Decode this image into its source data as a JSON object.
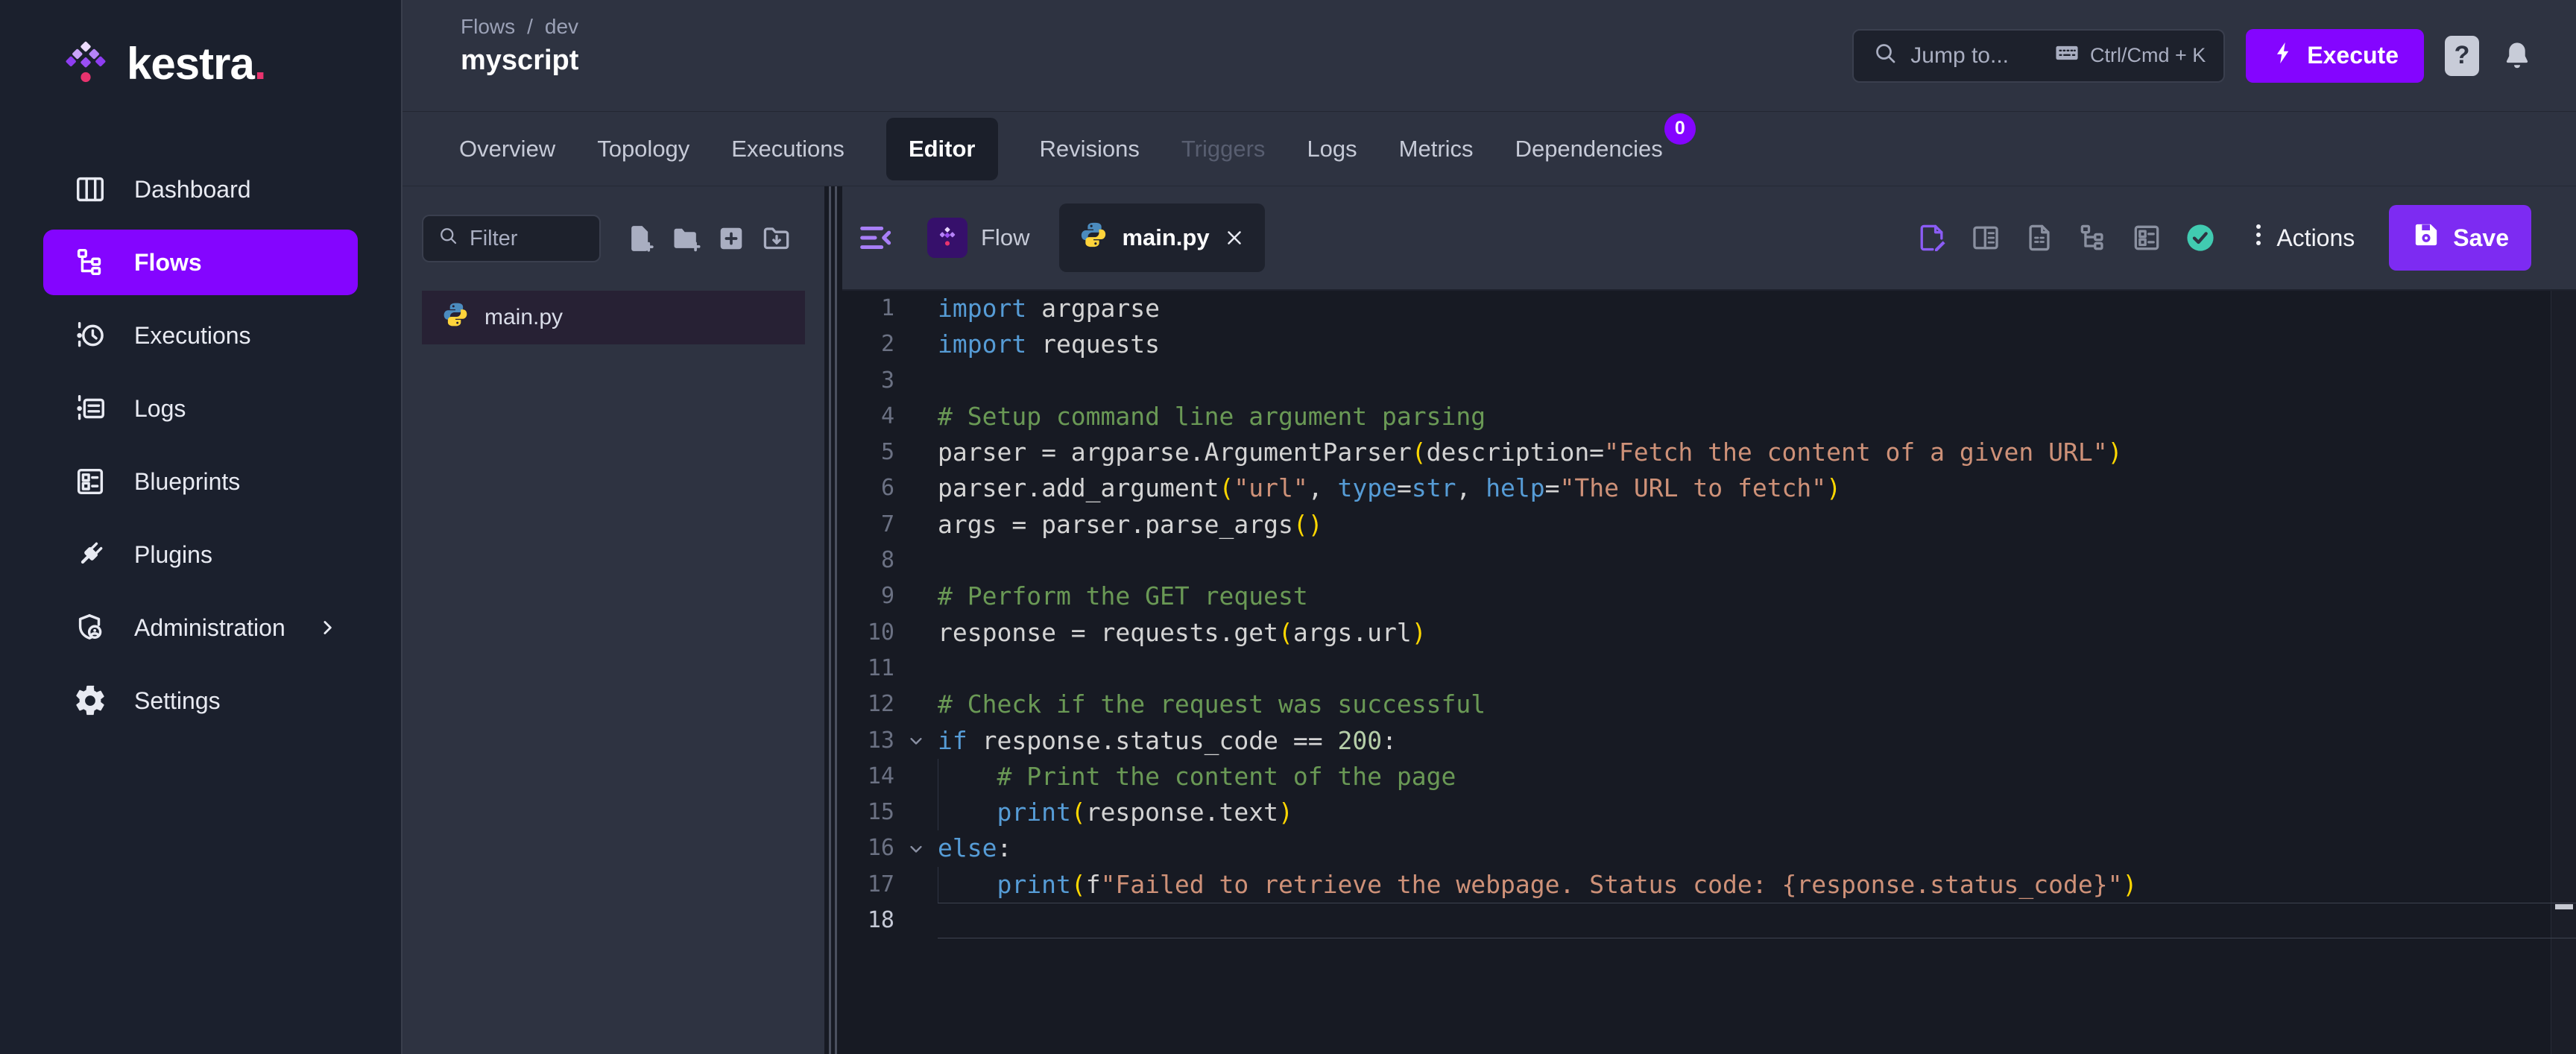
{
  "palette": {
    "accent": "#8405FF",
    "save": "#7D2BF2",
    "brand_pink": "#E8336E",
    "check_green": "#41CBB1",
    "keyword": "#569CD6",
    "string": "#CE9178",
    "comment": "#6A9955",
    "number": "#B5CEA8",
    "bracket": "#FFD700",
    "code_text": "#D4D4D4"
  },
  "brand": {
    "name": "kestra",
    "dot": "."
  },
  "sidebar": {
    "items": [
      {
        "label": "Dashboard",
        "icon": "dashboard-icon",
        "active": false
      },
      {
        "label": "Flows",
        "icon": "flows-icon",
        "active": true
      },
      {
        "label": "Executions",
        "icon": "executions-icon",
        "active": false
      },
      {
        "label": "Logs",
        "icon": "logs-icon",
        "active": false
      },
      {
        "label": "Blueprints",
        "icon": "blueprints-icon",
        "active": false
      },
      {
        "label": "Plugins",
        "icon": "plugins-icon",
        "active": false
      },
      {
        "label": "Administration",
        "icon": "administration-icon",
        "active": false,
        "chevron": true
      },
      {
        "label": "Settings",
        "icon": "settings-icon",
        "active": false
      }
    ]
  },
  "header": {
    "breadcrumb": [
      "Flows",
      "dev"
    ],
    "breadcrumb_separator": "/",
    "title": "myscript",
    "search": {
      "placeholder": "Jump to...",
      "shortcut": "Ctrl/Cmd + K"
    },
    "execute_label": "Execute",
    "help_label": "?"
  },
  "flow_tabs": {
    "items": [
      {
        "label": "Overview",
        "state": "normal"
      },
      {
        "label": "Topology",
        "state": "normal"
      },
      {
        "label": "Executions",
        "state": "normal"
      },
      {
        "label": "Editor",
        "state": "active"
      },
      {
        "label": "Revisions",
        "state": "normal"
      },
      {
        "label": "Triggers",
        "state": "disabled"
      },
      {
        "label": "Logs",
        "state": "normal"
      },
      {
        "label": "Metrics",
        "state": "normal"
      },
      {
        "label": "Dependencies",
        "state": "normal",
        "badge": "0"
      }
    ]
  },
  "explorer": {
    "filter_placeholder": "Filter",
    "toolbar_icons": [
      "new-file-icon",
      "new-folder-icon",
      "add-square-icon",
      "import-folder-icon"
    ],
    "files": [
      {
        "name": "main.py",
        "icon": "python-icon",
        "selected": true
      }
    ]
  },
  "editor": {
    "tabs": [
      {
        "label": "Flow",
        "icon": "kestra-icon",
        "active": false,
        "closable": false
      },
      {
        "label": "main.py",
        "icon": "python-icon",
        "active": true,
        "closable": true
      }
    ],
    "right_tools": [
      {
        "icon": "edit-document-icon",
        "color": "#8B5CF6"
      },
      {
        "icon": "split-panel-icon",
        "color": "#8A90A0"
      },
      {
        "icon": "document-icon",
        "color": "#8A90A0"
      },
      {
        "icon": "tree-icon",
        "color": "#8A90A0"
      },
      {
        "icon": "list-box-icon",
        "color": "#8A90A0"
      },
      {
        "icon": "check-circle-icon",
        "color": "#41CBB1"
      }
    ],
    "actions_label": "Actions",
    "save_label": "Save",
    "code": {
      "language": "python",
      "active_line": 18,
      "lines": [
        {
          "n": 1,
          "tokens": [
            {
              "c": "kw",
              "t": "import"
            },
            {
              "c": "txt",
              "t": " argparse"
            }
          ]
        },
        {
          "n": 2,
          "tokens": [
            {
              "c": "kw",
              "t": "import"
            },
            {
              "c": "txt",
              "t": " requests"
            }
          ]
        },
        {
          "n": 3,
          "tokens": []
        },
        {
          "n": 4,
          "tokens": [
            {
              "c": "com",
              "t": "# Setup command line argument parsing"
            }
          ]
        },
        {
          "n": 5,
          "tokens": [
            {
              "c": "txt",
              "t": "parser = argparse.ArgumentParser"
            },
            {
              "c": "par",
              "t": "("
            },
            {
              "c": "txt",
              "t": "description="
            },
            {
              "c": "str",
              "t": "\"Fetch the content of a given URL\""
            },
            {
              "c": "par",
              "t": ")"
            }
          ]
        },
        {
          "n": 6,
          "tokens": [
            {
              "c": "txt",
              "t": "parser.add_argument"
            },
            {
              "c": "par",
              "t": "("
            },
            {
              "c": "str",
              "t": "\"url\""
            },
            {
              "c": "txt",
              "t": ", "
            },
            {
              "c": "kw",
              "t": "type"
            },
            {
              "c": "txt",
              "t": "="
            },
            {
              "c": "kw",
              "t": "str"
            },
            {
              "c": "txt",
              "t": ", "
            },
            {
              "c": "kw",
              "t": "help"
            },
            {
              "c": "txt",
              "t": "="
            },
            {
              "c": "str",
              "t": "\"The URL to fetch\""
            },
            {
              "c": "par",
              "t": ")"
            }
          ]
        },
        {
          "n": 7,
          "tokens": [
            {
              "c": "txt",
              "t": "args = parser.parse_args"
            },
            {
              "c": "par",
              "t": "()"
            }
          ]
        },
        {
          "n": 8,
          "tokens": []
        },
        {
          "n": 9,
          "tokens": [
            {
              "c": "com",
              "t": "# Perform the GET request"
            }
          ]
        },
        {
          "n": 10,
          "tokens": [
            {
              "c": "txt",
              "t": "response = requests.get"
            },
            {
              "c": "par",
              "t": "("
            },
            {
              "c": "txt",
              "t": "args.url"
            },
            {
              "c": "par",
              "t": ")"
            }
          ]
        },
        {
          "n": 11,
          "tokens": []
        },
        {
          "n": 12,
          "tokens": [
            {
              "c": "com",
              "t": "# Check if the request was successful"
            }
          ]
        },
        {
          "n": 13,
          "fold": true,
          "tokens": [
            {
              "c": "kw",
              "t": "if"
            },
            {
              "c": "txt",
              "t": " response.status_code == "
            },
            {
              "c": "num",
              "t": "200"
            },
            {
              "c": "txt",
              "t": ":"
            }
          ]
        },
        {
          "n": 14,
          "indent": 4,
          "guide": true,
          "tokens": [
            {
              "c": "com",
              "t": "# Print the content of the page"
            }
          ]
        },
        {
          "n": 15,
          "indent": 4,
          "guide": true,
          "tokens": [
            {
              "c": "kw",
              "t": "print"
            },
            {
              "c": "par",
              "t": "("
            },
            {
              "c": "txt",
              "t": "response.text"
            },
            {
              "c": "par",
              "t": ")"
            }
          ]
        },
        {
          "n": 16,
          "fold": true,
          "tokens": [
            {
              "c": "kw",
              "t": "else"
            },
            {
              "c": "txt",
              "t": ":"
            }
          ]
        },
        {
          "n": 17,
          "indent": 4,
          "guide": true,
          "tokens": [
            {
              "c": "kw",
              "t": "print"
            },
            {
              "c": "par",
              "t": "("
            },
            {
              "c": "txt",
              "t": "f"
            },
            {
              "c": "str",
              "t": "\"Failed to retrieve the webpage. Status code: {response.status_code}\""
            },
            {
              "c": "par",
              "t": ")"
            }
          ]
        },
        {
          "n": 18,
          "tokens": []
        }
      ]
    }
  }
}
